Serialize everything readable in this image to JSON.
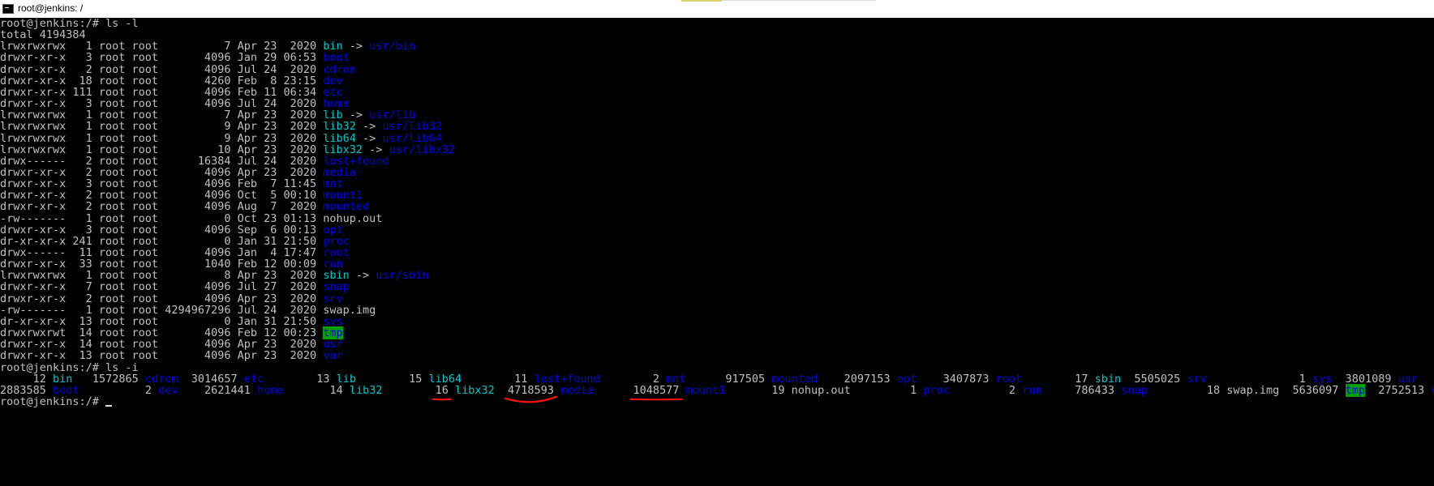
{
  "window": {
    "title": "root@jenkins: /"
  },
  "cmd1": "root@jenkins:/# ls -l",
  "total": "total 4194384",
  "long_list": [
    {
      "p": "lrwxrwxrwx   1 root root          7 Apr 23  2020 ",
      "n": "bin",
      "t": "lnk",
      "a": "usr/bin"
    },
    {
      "p": "drwxr-xr-x   3 root root       4096 Jan 29 06:53 ",
      "n": "boot",
      "t": "dir"
    },
    {
      "p": "drwxr-xr-x   2 root root       4096 Jul 24  2020 ",
      "n": "cdrom",
      "t": "dir"
    },
    {
      "p": "drwxr-xr-x  18 root root       4260 Feb  8 23:15 ",
      "n": "dev",
      "t": "dir"
    },
    {
      "p": "drwxr-xr-x 111 root root       4096 Feb 11 06:34 ",
      "n": "etc",
      "t": "dir"
    },
    {
      "p": "drwxr-xr-x   3 root root       4096 Jul 24  2020 ",
      "n": "home",
      "t": "dir"
    },
    {
      "p": "lrwxrwxrwx   1 root root          7 Apr 23  2020 ",
      "n": "lib",
      "t": "lnk",
      "a": "usr/lib"
    },
    {
      "p": "lrwxrwxrwx   1 root root          9 Apr 23  2020 ",
      "n": "lib32",
      "t": "lnk",
      "a": "usr/lib32"
    },
    {
      "p": "lrwxrwxrwx   1 root root          9 Apr 23  2020 ",
      "n": "lib64",
      "t": "lnk",
      "a": "usr/lib64"
    },
    {
      "p": "lrwxrwxrwx   1 root root         10 Apr 23  2020 ",
      "n": "libx32",
      "t": "lnk",
      "a": "usr/libx32"
    },
    {
      "p": "drwx------   2 root root      16384 Jul 24  2020 ",
      "n": "lost+found",
      "t": "dir"
    },
    {
      "p": "drwxr-xr-x   2 root root       4096 Apr 23  2020 ",
      "n": "media",
      "t": "dir"
    },
    {
      "p": "drwxr-xr-x   3 root root       4096 Feb  7 11:45 ",
      "n": "mnt",
      "t": "dir"
    },
    {
      "p": "drwxr-xr-x   2 root root       4096 Oct  5 00:10 ",
      "n": "mount1",
      "t": "dir"
    },
    {
      "p": "drwxr-xr-x   2 root root       4096 Aug  7  2020 ",
      "n": "mounted",
      "t": "dir"
    },
    {
      "p": "-rw-------   1 root root          0 Oct 23 01:13 ",
      "n": "nohup.out",
      "t": "file"
    },
    {
      "p": "drwxr-xr-x   3 root root       4096 Sep  6 00:13 ",
      "n": "opt",
      "t": "dir"
    },
    {
      "p": "dr-xr-xr-x 241 root root          0 Jan 31 21:50 ",
      "n": "proc",
      "t": "dir"
    },
    {
      "p": "drwx------  11 root root       4096 Jan  4 17:47 ",
      "n": "root",
      "t": "dir"
    },
    {
      "p": "drwxr-xr-x  33 root root       1040 Feb 12 00:09 ",
      "n": "run",
      "t": "dir"
    },
    {
      "p": "lrwxrwxrwx   1 root root          8 Apr 23  2020 ",
      "n": "sbin",
      "t": "lnk",
      "a": "usr/sbin"
    },
    {
      "p": "drwxr-xr-x   7 root root       4096 Jul 27  2020 ",
      "n": "snap",
      "t": "dir"
    },
    {
      "p": "drwxr-xr-x   2 root root       4096 Apr 23  2020 ",
      "n": "srv",
      "t": "dir"
    },
    {
      "p": "-rw-------   1 root root 4294967296 Jul 24  2020 ",
      "n": "swap.img",
      "t": "file"
    },
    {
      "p": "dr-xr-xr-x  13 root root          0 Jan 31 21:50 ",
      "n": "sys",
      "t": "dir"
    },
    {
      "p": "drwxrwxrwt  14 root root       4096 Feb 12 00:23 ",
      "n": "tmp",
      "t": "tmp"
    },
    {
      "p": "drwxr-xr-x  14 root root       4096 Apr 23  2020 ",
      "n": "usr",
      "t": "dir"
    },
    {
      "p": "drwxr-xr-x  13 root root       4096 Apr 23  2020 ",
      "n": "var",
      "t": "dir"
    }
  ],
  "arrow": " -> ",
  "cmd2": "root@jenkins:/# ls -i",
  "inode_rows": [
    [
      {
        "i": "     12 ",
        "n": "bin",
        "t": "lnk",
        "g": "   "
      },
      {
        "i": "1572865 ",
        "n": "cdrom",
        "t": "dir",
        "g": "  "
      },
      {
        "i": "3014657 ",
        "n": "etc",
        "t": "dir",
        "g": "        "
      },
      {
        "i": "13 ",
        "n": "lib",
        "t": "lnk",
        "g": "        "
      },
      {
        "i": "15 ",
        "n": "lib64",
        "t": "lnk",
        "g": "        "
      },
      {
        "i": "11 ",
        "n": "lost+found",
        "t": "dir",
        "g": "        "
      },
      {
        "i": "2 ",
        "n": "mnt",
        "t": "dir",
        "g": "      "
      },
      {
        "i": "917505 ",
        "n": "mounted",
        "t": "dir",
        "g": "    "
      },
      {
        "i": "2097153 ",
        "n": "opt",
        "t": "dir",
        "g": "    "
      },
      {
        "i": "3407873 ",
        "n": "root",
        "t": "dir",
        "g": "        "
      },
      {
        "i": "17 ",
        "n": "sbin",
        "t": "lnk",
        "g": "  "
      },
      {
        "i": "5505025 ",
        "n": "srv",
        "t": "dir",
        "g": "              "
      },
      {
        "i": "1 ",
        "n": "sys",
        "t": "dir",
        "g": "  "
      },
      {
        "i": "3801089 ",
        "n": "usr",
        "t": "dir",
        "g": ""
      }
    ],
    [
      {
        "i": "2883585 ",
        "n": "boot",
        "t": "dir",
        "g": "          "
      },
      {
        "i": "2 ",
        "n": "dev",
        "t": "dir",
        "g": "    "
      },
      {
        "i": "2621441 ",
        "n": "home",
        "t": "dir",
        "g": "       "
      },
      {
        "i": "14 ",
        "n": "lib32",
        "t": "lnk",
        "g": "        "
      },
      {
        "i": "16 ",
        "n": "libx32",
        "t": "lnk",
        "g": "  "
      },
      {
        "i": "4718593 ",
        "n": "media",
        "t": "dir",
        "g": "      "
      },
      {
        "i": "1048577 ",
        "n": "mount1",
        "t": "dir",
        "g": "       "
      },
      {
        "i": "19 ",
        "n": "nohup.out",
        "t": "file",
        "g": "         "
      },
      {
        "i": "1 ",
        "n": "proc",
        "t": "dir",
        "g": "         "
      },
      {
        "i": "2 ",
        "n": "run",
        "t": "dir",
        "g": "     "
      },
      {
        "i": "786433 ",
        "n": "snap",
        "t": "dir",
        "g": "         "
      },
      {
        "i": "18 ",
        "n": "swap.img",
        "t": "file",
        "g": "  "
      },
      {
        "i": "5636097 ",
        "n": "tmp",
        "t": "tmp",
        "g": "  "
      },
      {
        "i": "2752513 ",
        "n": "var",
        "t": "dir",
        "g": ""
      }
    ]
  ],
  "prompt": "root@jenkins:/# ",
  "colors": {
    "background": "#000000",
    "text": "#c0c0c0",
    "directory": "#0000ee",
    "symlink": "#00c8c8",
    "sticky_bg": "#00a000",
    "annotation": "#ff1010"
  }
}
